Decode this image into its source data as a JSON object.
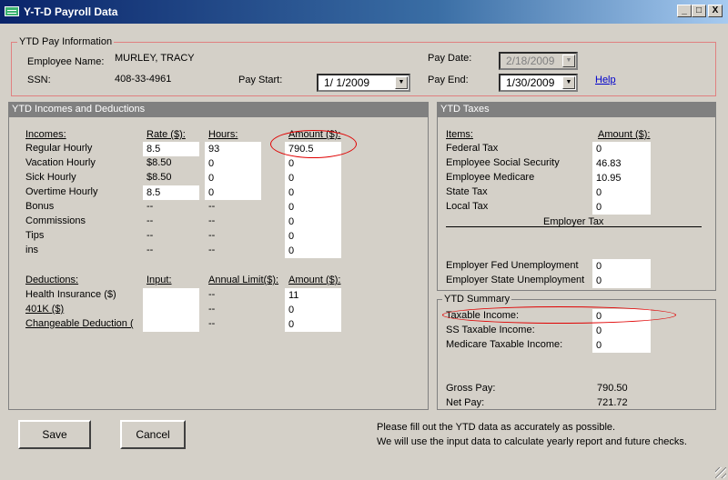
{
  "window": {
    "title": "Y-T-D Payroll Data",
    "min": "_",
    "max": "□",
    "close": "X"
  },
  "pay_info": {
    "legend": "YTD Pay Information",
    "employee_name_label": "Employee Name:",
    "employee_name": "MURLEY, TRACY",
    "ssn_label": "SSN:",
    "ssn": "408-33-4961",
    "pay_start_label": "Pay Start:",
    "pay_start": "1/ 1/2009",
    "pay_date_label": "Pay Date:",
    "pay_date": "2/18/2009",
    "pay_end_label": "Pay End:",
    "pay_end": "1/30/2009",
    "help": "Help"
  },
  "incomes": {
    "section": "YTD Incomes and Deductions",
    "headers": {
      "items": "Incomes:",
      "rate": "Rate ($):",
      "hours": "Hours:",
      "amount": "Amount ($):"
    },
    "rows": [
      {
        "name": "Regular Hourly",
        "rate": "8.5",
        "hours": "93",
        "amount": "790.5"
      },
      {
        "name": "Vacation Hourly",
        "rate": "$8.50",
        "hours": "0",
        "amount": "0"
      },
      {
        "name": "Sick Hourly",
        "rate": "$8.50",
        "hours": "0",
        "amount": "0"
      },
      {
        "name": "Overtime Hourly",
        "rate": "8.5",
        "hours": "0",
        "amount": "0"
      },
      {
        "name": "Bonus",
        "rate": "--",
        "hours": "--",
        "amount": "0"
      },
      {
        "name": "Commissions",
        "rate": "--",
        "hours": "--",
        "amount": "0"
      },
      {
        "name": "Tips",
        "rate": "--",
        "hours": "--",
        "amount": "0"
      },
      {
        "name": "ins",
        "rate": "--",
        "hours": "--",
        "amount": "0"
      }
    ]
  },
  "deductions": {
    "headers": {
      "items": "Deductions:",
      "input": "Input:",
      "limit": "Annual Limit($):",
      "amount": "Amount ($):"
    },
    "rows": [
      {
        "name": "Health Insurance  ($)",
        "input": "",
        "limit": "--",
        "amount": "11"
      },
      {
        "name": "401K  ($)",
        "input": "",
        "limit": "--",
        "amount": "0"
      },
      {
        "name": "Changeable  Deduction  (",
        "input": "",
        "limit": "--",
        "amount": "0"
      }
    ]
  },
  "taxes": {
    "section": "YTD Taxes",
    "headers": {
      "items": "Items:",
      "amount": "Amount ($):"
    },
    "rows": [
      {
        "name": "Federal Tax",
        "amount": "0"
      },
      {
        "name": "Employee Social Security",
        "amount": "46.83"
      },
      {
        "name": "Employee Medicare",
        "amount": "10.95"
      },
      {
        "name": "State Tax",
        "amount": "0"
      },
      {
        "name": "Local Tax",
        "amount": "0"
      }
    ],
    "employer_tax_label": "Employer Tax",
    "employer_rows": [
      {
        "name": "Employer Fed Unemployment",
        "amount": "0"
      },
      {
        "name": "Employer State Unemployment",
        "amount": "0"
      }
    ]
  },
  "summary": {
    "legend": "YTD Summary",
    "rows": [
      {
        "name": "Taxable Income:",
        "value": "0"
      },
      {
        "name": "SS Taxable Income:",
        "value": "0"
      },
      {
        "name": "Medicare Taxable Income:",
        "value": "0"
      }
    ],
    "gross_pay_label": "Gross Pay:",
    "gross_pay": "790.50",
    "net_pay_label": "Net Pay:",
    "net_pay": "721.72"
  },
  "buttons": {
    "save": "Save",
    "cancel": "Cancel"
  },
  "note": {
    "line1": "Please fill out the YTD data as accurately as possible.",
    "line2": "We will use the input data to calculate yearly report and future checks."
  },
  "colors": {
    "titlebar": "#0a246a",
    "section_header": "#808080",
    "annotation_oval": "#e00000",
    "link": "#0000cc"
  }
}
